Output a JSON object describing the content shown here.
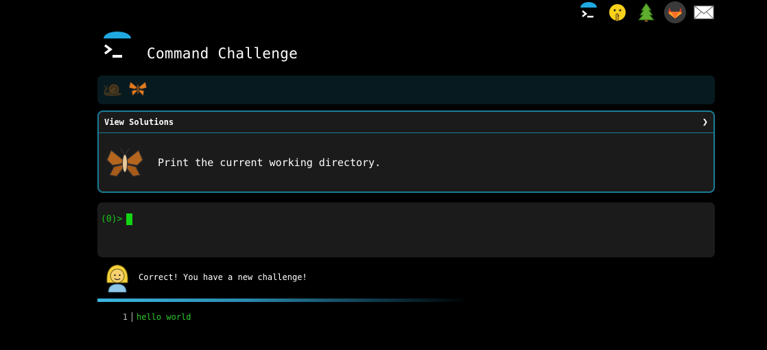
{
  "app": {
    "title": "Command Challenge"
  },
  "top_nav": [
    {
      "icon": "terminal-icon"
    },
    {
      "icon": "shushing-face-icon"
    },
    {
      "icon": "tree-icon"
    },
    {
      "icon": "gitlab-icon"
    },
    {
      "icon": "mail-icon"
    }
  ],
  "level_bar": {
    "items": [
      {
        "icon": "snail-icon",
        "state": "completed"
      },
      {
        "icon": "butterfly-icon",
        "state": "current"
      }
    ]
  },
  "challenge": {
    "header_label": "View Solutions",
    "expand_icon": "chevron-right-icon",
    "icon": "butterfly-icon",
    "description": "Print the current working directory."
  },
  "terminal": {
    "prompt": "(0)>",
    "input_value": ""
  },
  "message": {
    "avatar": "woman-avatar-icon",
    "text": "Correct! You have a new challenge!"
  },
  "progress": {
    "value": 0.45
  },
  "output": {
    "lines": [
      {
        "number": "1",
        "text": "hello world"
      }
    ]
  },
  "colors": {
    "accent": "#1a7d96",
    "prompt_green": "#17c917",
    "panel_bg": "#1b1b1b",
    "level_bar_bg": "#071a1f"
  }
}
